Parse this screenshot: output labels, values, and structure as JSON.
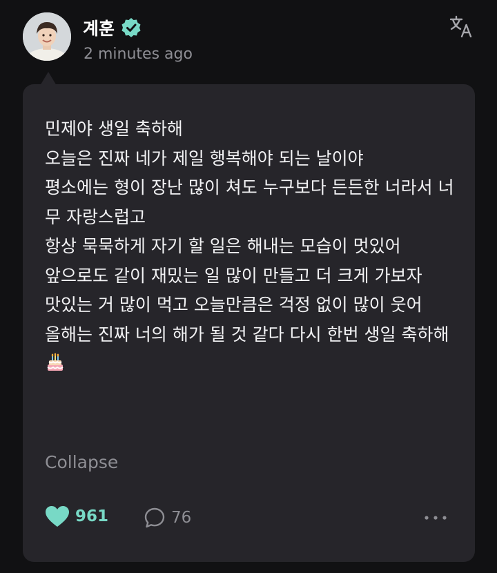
{
  "post": {
    "author": "계훈",
    "verified": true,
    "timestamp": "2 minutes ago",
    "translate_icon": "translate-icon",
    "message": "민제야 생일 축하해\n오늘은 진짜 네가 제일 행복해야 되는 날이야\n평소에는 형이 장난 많이 쳐도 누구보다 든든한 너라서 너무 자랑스럽고\n항상 묵묵하게 자기 할 일은 해내는 모습이 멋있어\n앞으로도 같이 재밌는 일 많이 만들고 더 크게 가보자\n맛있는 거 많이 먹고 오늘만큼은 걱정 없이 많이 웃어\n올해는 진짜 너의 해가 될 것 같다 다시 한번 생일 축하해",
    "emoji": "birthday-cake-icon",
    "collapse_label": "Collapse",
    "likes": "961",
    "comments": "76"
  },
  "colors": {
    "background": "#111113",
    "bubble": "#26252a",
    "accent": "#78d9c6",
    "muted": "#8e8e94"
  }
}
